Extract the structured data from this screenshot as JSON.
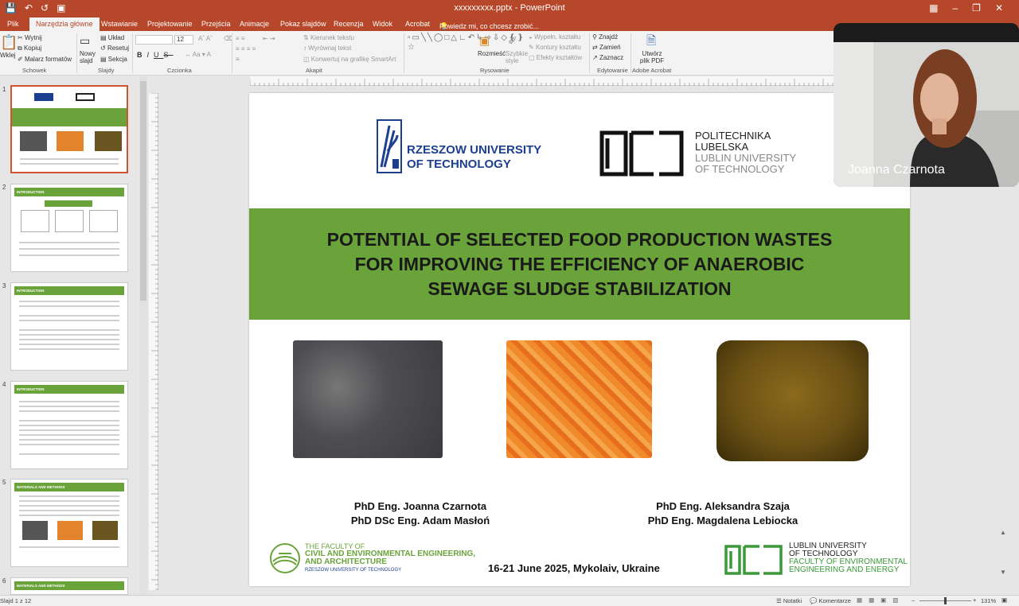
{
  "app": {
    "window_title": "xxxxxxxxx.pptx - PowerPoint"
  },
  "tabs": [
    {
      "label": "Plik"
    },
    {
      "label": "Narzędzia główne"
    },
    {
      "label": "Wstawianie"
    },
    {
      "label": "Projektowanie"
    },
    {
      "label": "Przejścia"
    },
    {
      "label": "Animacje"
    },
    {
      "label": "Pokaz slajdów"
    },
    {
      "label": "Recenzja"
    },
    {
      "label": "Widok"
    },
    {
      "label": "Acrobat"
    },
    {
      "label": "Powiedz mi, co chcesz zrobić..."
    }
  ],
  "ribbon": {
    "clipboard": {
      "paste": "Wklej",
      "cut": "Wytnij",
      "copy": "Kopiuj",
      "format_painter": "Malarz formatów",
      "group": "Schowek"
    },
    "slides": {
      "new_slide": "Nowy slajd",
      "layout": "Układ",
      "reset": "Resetuj",
      "section": "Sekcja",
      "group": "Slajdy"
    },
    "font": {
      "size": "12",
      "group": "Czcionka"
    },
    "paragraph": {
      "text_direction": "Kierunek tekstu",
      "align_text": "Wyrównaj tekst",
      "smartart": "Konwertuj na grafikę SmartArt",
      "group": "Akapit"
    },
    "drawing": {
      "arrange": "Rozmieść",
      "quick_styles": "Szybkie style",
      "shape_fill": "Wypełn. kształtu",
      "shape_outline": "Kontury kształtu",
      "shape_effects": "Efekty kształtów",
      "group": "Rysowanie"
    },
    "editing": {
      "find": "Znajdź",
      "replace": "Zamień",
      "select": "Zaznacz",
      "group": "Edytowanie"
    },
    "acrobat": {
      "create_pdf": "Utwórz plik PDF",
      "group": "Adobe Acrobat"
    }
  },
  "thumbnails": {
    "numbers": [
      "1",
      "2",
      "3",
      "4",
      "5",
      "6"
    ],
    "headers": [
      "INTRODUCTION",
      "INTRODUCTION",
      "INTRODUCTION",
      "MATERIALS AND METHODS",
      "MATERIALS AND METHODS"
    ]
  },
  "slide": {
    "title": "POTENTIAL OF SELECTED FOOD PRODUCTION WASTES FOR IMPROVING THE EFFICIENCY OF ANAEROBIC SEWAGE SLUDGE STABILIZATION",
    "rzeszow_logo": {
      "line1": "RZESZOW UNIVERSITY",
      "line2": "OF TECHNOLOGY"
    },
    "lublin_logo": {
      "line1": "POLITECHNIKA",
      "line2": "LUBELSKA",
      "line3": "LUBLIN UNIVERSITY",
      "line4": "OF TECHNOLOGY"
    },
    "authors_left": [
      "PhD Eng. Joanna Czarnota",
      "PhD DSc Eng. Adam Masłoń"
    ],
    "authors_right": [
      "PhD Eng. Aleksandra Szaja",
      "PhD Eng. Magdalena Lebiocka"
    ],
    "faculty": {
      "line1": "THE FACULTY OF",
      "line2": "CIVIL AND ENVIRONMENTAL ENGINEERING,",
      "line3": "AND ARCHITECTURE",
      "line4": "RZESZOW UNIVERSITY OF TECHNOLOGY"
    },
    "lublin_faculty": {
      "line1": "LUBLIN UNIVERSITY",
      "line2": "OF TECHNOLOGY",
      "line3": "FACULTY OF ENVIRONMENTAL",
      "line4": "ENGINEERING AND ENERGY"
    },
    "date_place": "16-21 June 2025, Mykolaiv, Ukraine"
  },
  "video": {
    "participant_name": "Joanna Czarnota"
  },
  "status": {
    "slide_counter": "Slajd 1 z 12",
    "notes": "Notatki",
    "comments": "Komentarze",
    "zoom": "131%"
  },
  "colors": {
    "accent": "#b7472a",
    "banner_green": "#6aa33a",
    "rzeszow_blue": "#1d3f8f"
  }
}
